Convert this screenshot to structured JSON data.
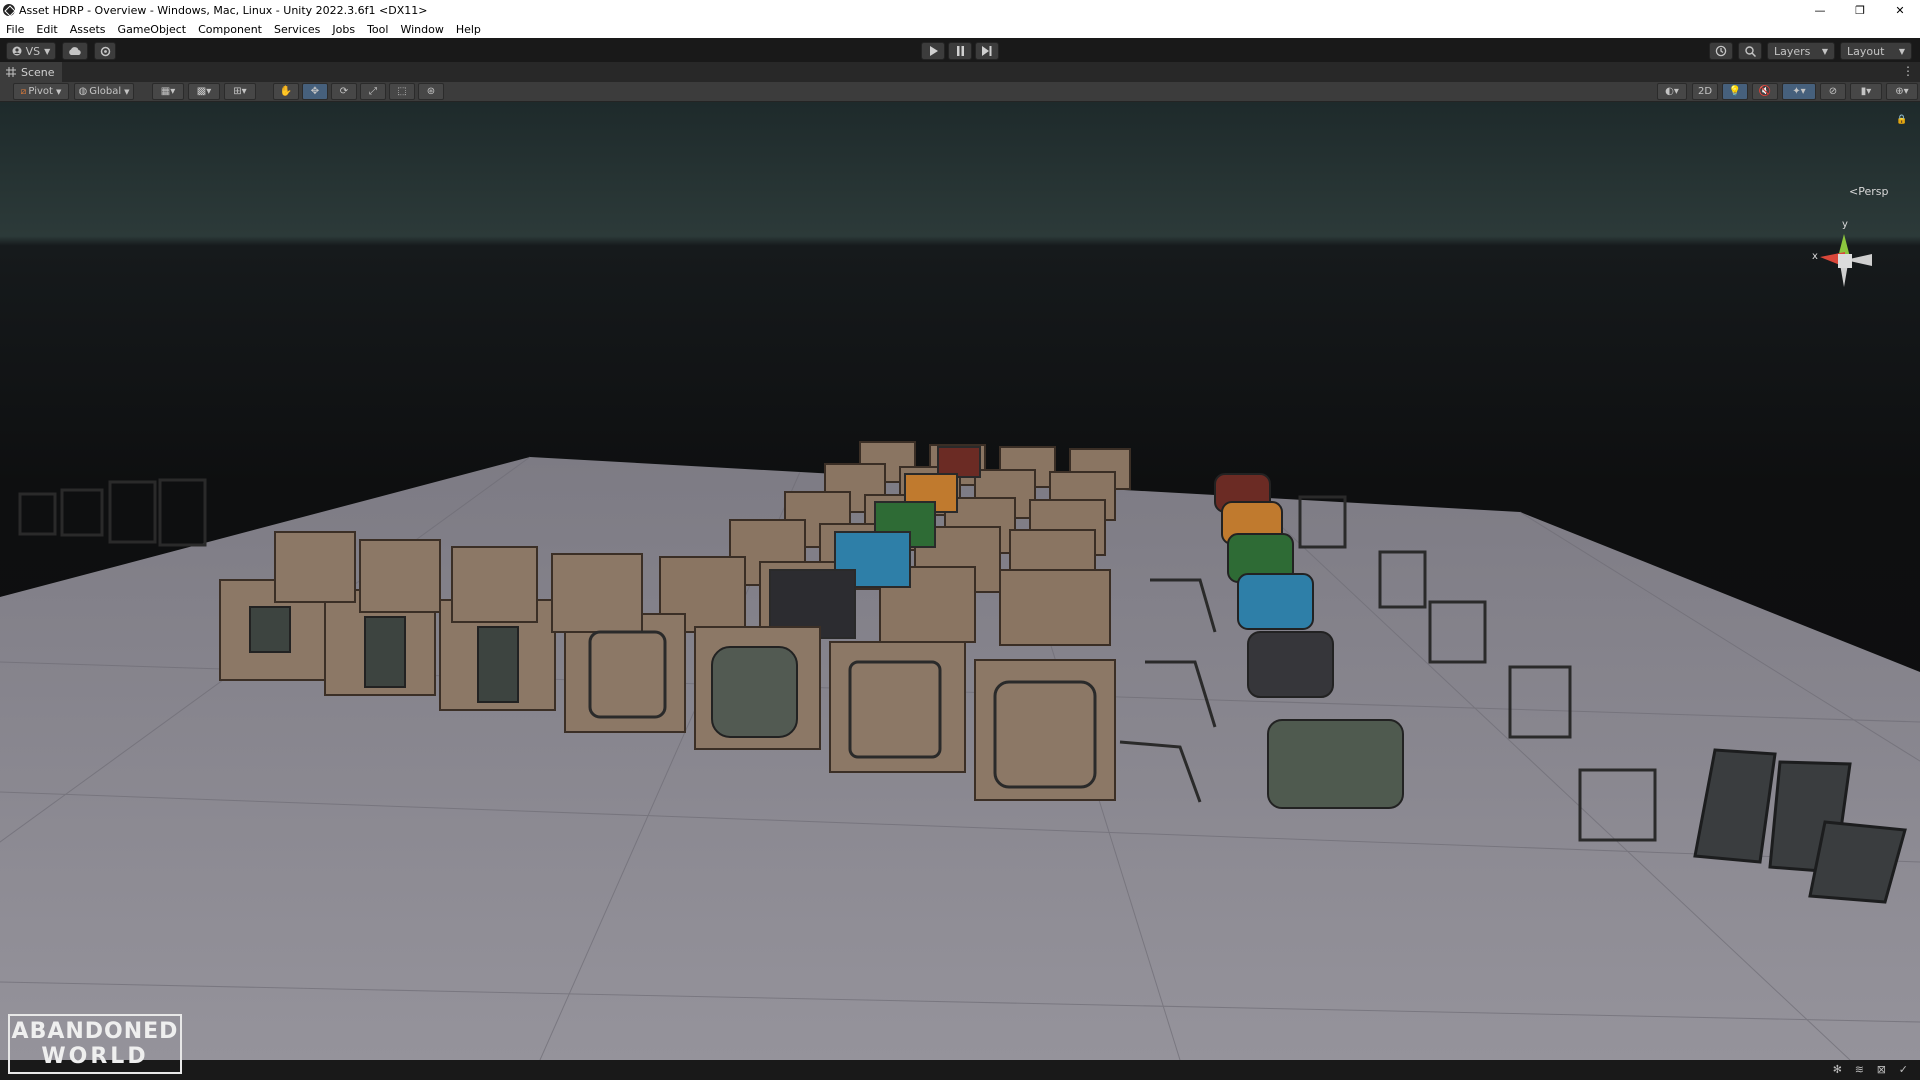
{
  "window": {
    "title": "Asset HDRP - Overview - Windows, Mac, Linux - Unity 2022.3.6f1 <DX11>",
    "minimize": "—",
    "maximize": "❐",
    "close": "✕"
  },
  "menu": [
    "File",
    "Edit",
    "Assets",
    "GameObject",
    "Component",
    "Services",
    "Jobs",
    "Tool",
    "Window",
    "Help"
  ],
  "toolbar": {
    "account_label": "VS",
    "layers_label": "Layers",
    "layout_label": "Layout"
  },
  "scene_tab": {
    "label": "Scene"
  },
  "scene_toolbar": {
    "pivot_label": "Pivot",
    "global_label": "Global",
    "mode_2d_label": "2D"
  },
  "viewport": {
    "projection_label": "Persp",
    "axis_x": "x",
    "axis_y": "y"
  },
  "logo": {
    "line1": "ABANDONED",
    "line2": "WORLD"
  },
  "colors": {
    "accent": "#46607c",
    "toolbar_bg": "#191919",
    "panel_bg": "#3c3c3c",
    "floor": "#8d8b94"
  }
}
